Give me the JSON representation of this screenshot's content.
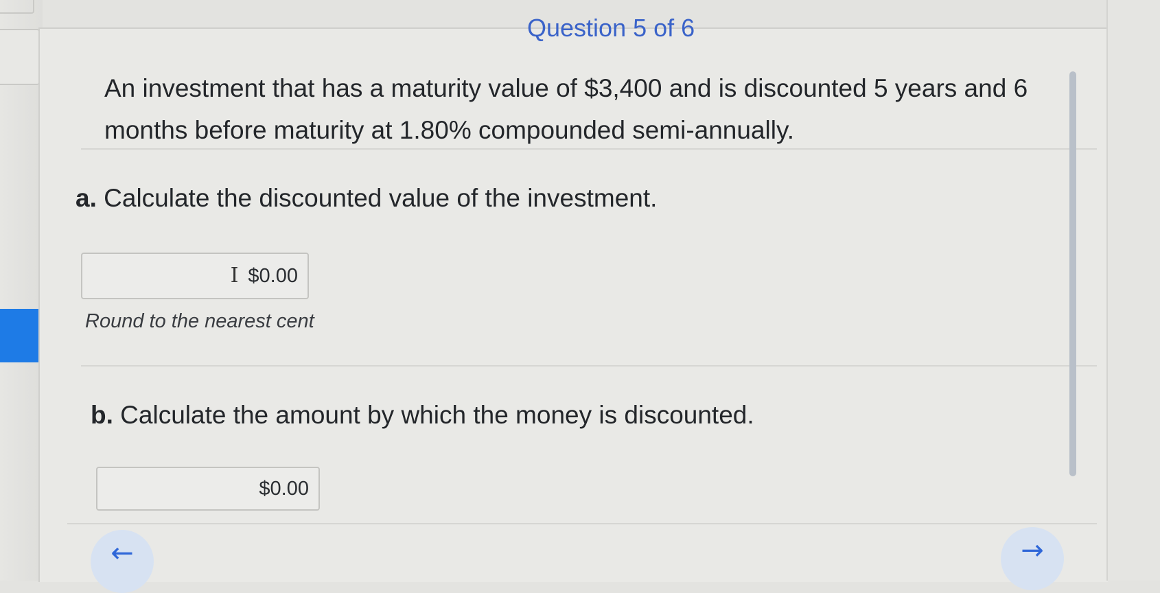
{
  "header": {
    "title": "Question 5 of 6"
  },
  "question": {
    "text": "An investment that has a maturity value of $3,400 and is discounted 5 years and 6 months before maturity at 1.80% compounded semi-annually."
  },
  "part_a": {
    "letter": "a.",
    "prompt": "Calculate the discounted value of the investment.",
    "answer_value": "$0.00",
    "hint": "Round to the nearest cent"
  },
  "part_b": {
    "letter": "b.",
    "prompt": "Calculate the amount by which the money is discounted.",
    "answer_value": "$0.00"
  },
  "nav": {
    "prev_icon": "arrow-left-icon",
    "next_icon": "arrow-right-icon"
  },
  "colors": {
    "accent": "#1e7be6",
    "link_blue": "#2f67d8"
  }
}
